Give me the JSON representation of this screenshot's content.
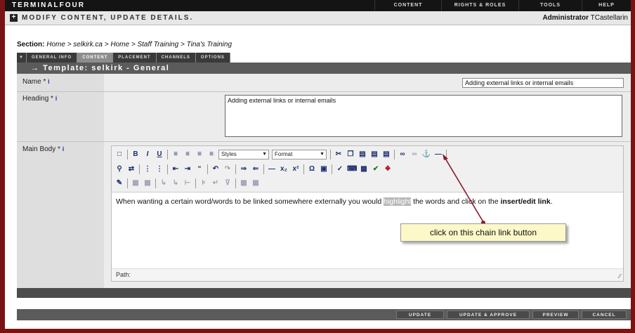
{
  "app": {
    "logo": "TERMINALFOUR",
    "nav": [
      "CONTENT",
      "RIGHTS & ROLES",
      "TOOLS",
      "HELP"
    ]
  },
  "subheader": {
    "title": "MODIFY CONTENT, UPDATE DETAILS.",
    "role": "Administrator",
    "user": "TCastellarin"
  },
  "section": {
    "label": "Section:",
    "path": "Home > selkirk.ca > Home > Staff Training > Tina's Training"
  },
  "tabs": [
    "GENERAL INFO",
    "CONTENT",
    "PLACEMENT",
    "CHANNELS",
    "OPTIONS"
  ],
  "active_tab": "CONTENT",
  "template": {
    "title": "→ Template: selkirk - General"
  },
  "fields": {
    "name_label": "Name *",
    "name_value": "Adding external links or internal emails",
    "heading_label": "Heading *",
    "heading_value": "Adding external links or internal emails",
    "body_label": "Main Body *",
    "info_glyph": "i"
  },
  "editor": {
    "styles_select": "Styles",
    "format_select": "Format",
    "content_before": "When wanting a certain word/words to be linked somewhere externally you would ",
    "content_highlight": "highlight",
    "content_after": " the words and click on the",
    "content_bold": "insert/edit link",
    "content_end": ".",
    "path_label": "Path:"
  },
  "callout": {
    "text": "click on this chain link button"
  },
  "buttons": {
    "update": "UPDATE",
    "update_approve": "UPDATE & APPROVE",
    "preview": "PREVIEW",
    "cancel": "CANCEL"
  },
  "colors": {
    "frame": "#7a1313",
    "topbar": "#141414",
    "template_bar": "#5b5b5b",
    "callout": "#fdf8c8",
    "arrow": "#8b1a2b",
    "info": "#1d3f9e"
  },
  "icons": {
    "toolbar_row1": [
      "new-document-icon",
      "bold-icon",
      "italic-icon",
      "underline-icon",
      "align-left-icon",
      "align-center-icon",
      "align-right-icon",
      "justify-icon",
      "cut-icon",
      "copy-icon",
      "paste-icon",
      "paste-text-icon",
      "paste-word-icon",
      "link-icon",
      "unlink-icon",
      "anchor-icon",
      "horizontal-rule-icon"
    ],
    "toolbar_row2": [
      "find-icon",
      "replace-icon",
      "bullet-list-icon",
      "numbered-list-icon",
      "outdent-icon",
      "indent-icon",
      "blockquote-icon",
      "undo-icon",
      "redo-icon",
      "ltr-icon",
      "rtl-icon",
      "hr-icon",
      "subscript-icon",
      "superscript-icon",
      "special-char-icon",
      "media-icon",
      "cleanup-icon",
      "code-icon",
      "image-icon",
      "spellcheck-icon",
      "help-icon"
    ],
    "toolbar_row3": [
      "edit-icon",
      "table-icon",
      "table-props-icon",
      "row-insert-icon",
      "col-insert-icon",
      "merge-icon",
      "split-icon",
      "delete-icon",
      "cell-props-icon",
      "row-props-icon"
    ]
  }
}
